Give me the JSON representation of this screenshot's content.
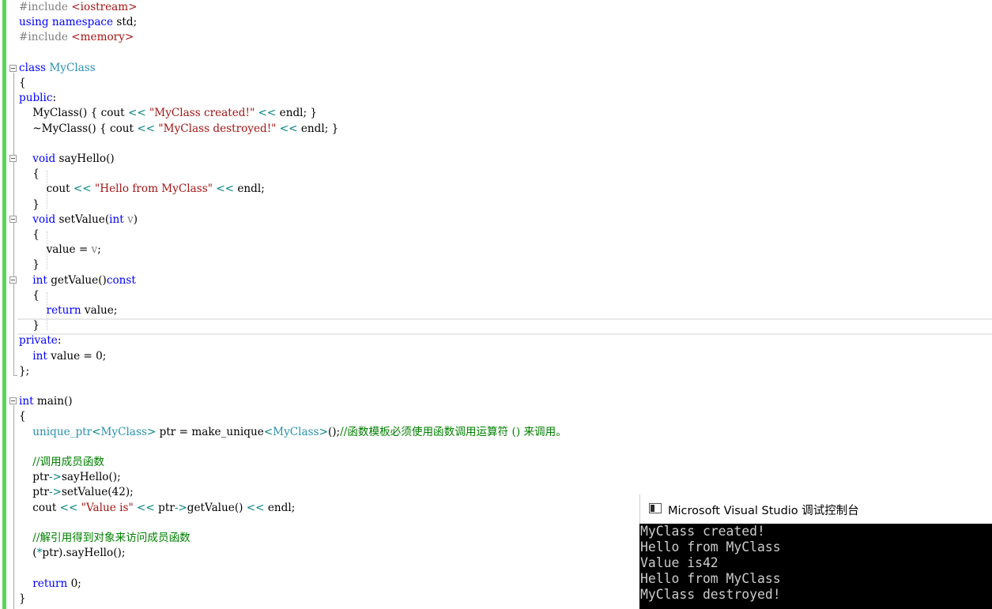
{
  "code_lines": [
    [
      {
        "t": "#include ",
        "c": "#808080"
      },
      {
        "t": "<iostream>",
        "c": "#a31515"
      }
    ],
    [
      {
        "t": "using namespace ",
        "c": "#0000ff"
      },
      {
        "t": "std;",
        "c": "#000000"
      }
    ],
    [
      {
        "t": "#include ",
        "c": "#808080"
      },
      {
        "t": "<memory>",
        "c": "#a31515"
      }
    ],
    [],
    [
      {
        "t": "class ",
        "c": "#0000ff"
      },
      {
        "t": "MyClass",
        "c": "#2b91af"
      }
    ],
    [
      {
        "t": "{",
        "c": "#000000"
      }
    ],
    [
      {
        "t": "public",
        "c": "#0000ff"
      },
      {
        "t": ":",
        "c": "#000000"
      }
    ],
    [
      {
        "t": "    MyClass() { cout ",
        "c": "#000000"
      },
      {
        "t": "<<",
        "c": "#008080"
      },
      {
        "t": " ",
        "c": "#000000"
      },
      {
        "t": "\"MyClass created!\"",
        "c": "#a31515"
      },
      {
        "t": " ",
        "c": "#000000"
      },
      {
        "t": "<<",
        "c": "#008080"
      },
      {
        "t": " endl; }",
        "c": "#000000"
      }
    ],
    [
      {
        "t": "    ~MyClass() { cout ",
        "c": "#000000"
      },
      {
        "t": "<<",
        "c": "#008080"
      },
      {
        "t": " ",
        "c": "#000000"
      },
      {
        "t": "\"MyClass destroyed!\"",
        "c": "#a31515"
      },
      {
        "t": " ",
        "c": "#000000"
      },
      {
        "t": "<<",
        "c": "#008080"
      },
      {
        "t": " endl; }",
        "c": "#000000"
      }
    ],
    [],
    [
      {
        "t": "    ",
        "c": "#000000"
      },
      {
        "t": "void",
        "c": "#0000ff"
      },
      {
        "t": " sayHello()",
        "c": "#000000"
      }
    ],
    [
      {
        "t": "    {",
        "c": "#000000"
      }
    ],
    [
      {
        "t": "        cout ",
        "c": "#000000"
      },
      {
        "t": "<<",
        "c": "#008080"
      },
      {
        "t": " ",
        "c": "#000000"
      },
      {
        "t": "\"Hello from MyClass\"",
        "c": "#a31515"
      },
      {
        "t": " ",
        "c": "#000000"
      },
      {
        "t": "<<",
        "c": "#008080"
      },
      {
        "t": " endl;",
        "c": "#000000"
      }
    ],
    [
      {
        "t": "    }",
        "c": "#000000"
      }
    ],
    [
      {
        "t": "    ",
        "c": "#000000"
      },
      {
        "t": "void",
        "c": "#0000ff"
      },
      {
        "t": " setValue(",
        "c": "#000000"
      },
      {
        "t": "int",
        "c": "#0000ff"
      },
      {
        "t": " ",
        "c": "#000000"
      },
      {
        "t": "v",
        "c": "#808080"
      },
      {
        "t": ")",
        "c": "#000000"
      }
    ],
    [
      {
        "t": "    {",
        "c": "#000000"
      }
    ],
    [
      {
        "t": "        value = ",
        "c": "#000000"
      },
      {
        "t": "v",
        "c": "#808080"
      },
      {
        "t": ";",
        "c": "#000000"
      }
    ],
    [
      {
        "t": "    }",
        "c": "#000000"
      }
    ],
    [
      {
        "t": "    ",
        "c": "#000000"
      },
      {
        "t": "int",
        "c": "#0000ff"
      },
      {
        "t": " getValue()",
        "c": "#000000"
      },
      {
        "t": "const",
        "c": "#0000ff"
      }
    ],
    [
      {
        "t": "    {",
        "c": "#000000"
      }
    ],
    [
      {
        "t": "        ",
        "c": "#000000"
      },
      {
        "t": "return",
        "c": "#0000ff"
      },
      {
        "t": " value;",
        "c": "#000000"
      }
    ],
    [
      {
        "t": "    }",
        "c": "#000000"
      }
    ],
    [
      {
        "t": "private",
        "c": "#0000ff"
      },
      {
        "t": ":",
        "c": "#000000"
      }
    ],
    [
      {
        "t": "    ",
        "c": "#000000"
      },
      {
        "t": "int",
        "c": "#0000ff"
      },
      {
        "t": " value = 0;",
        "c": "#000000"
      }
    ],
    [
      {
        "t": "};",
        "c": "#000000"
      }
    ],
    [],
    [
      {
        "t": "int",
        "c": "#0000ff"
      },
      {
        "t": " main()",
        "c": "#000000"
      }
    ],
    [
      {
        "t": "{",
        "c": "#000000"
      }
    ],
    [
      {
        "t": "    ",
        "c": "#000000"
      },
      {
        "t": "unique_ptr",
        "c": "#2b91af"
      },
      {
        "t": "<",
        "c": "#008080"
      },
      {
        "t": "MyClass",
        "c": "#2b91af"
      },
      {
        "t": ">",
        "c": "#008080"
      },
      {
        "t": " ptr = make_unique",
        "c": "#000000"
      },
      {
        "t": "<",
        "c": "#008080"
      },
      {
        "t": "MyClass",
        "c": "#2b91af"
      },
      {
        "t": ">",
        "c": "#008080"
      },
      {
        "t": "();",
        "c": "#000000"
      },
      {
        "t": "//函数模板必须使用函数调用运算符 () 来调用。",
        "c": "#008000"
      }
    ],
    [],
    [
      {
        "t": "    ",
        "c": "#000000"
      },
      {
        "t": "//调用成员函数",
        "c": "#008000"
      }
    ],
    [
      {
        "t": "    ptr",
        "c": "#000000"
      },
      {
        "t": "->",
        "c": "#008080"
      },
      {
        "t": "sayHello();",
        "c": "#000000"
      }
    ],
    [
      {
        "t": "    ptr",
        "c": "#000000"
      },
      {
        "t": "->",
        "c": "#008080"
      },
      {
        "t": "setValue(42);",
        "c": "#000000"
      }
    ],
    [
      {
        "t": "    cout ",
        "c": "#000000"
      },
      {
        "t": "<<",
        "c": "#008080"
      },
      {
        "t": " ",
        "c": "#000000"
      },
      {
        "t": "\"Value is\"",
        "c": "#a31515"
      },
      {
        "t": " ",
        "c": "#000000"
      },
      {
        "t": "<<",
        "c": "#008080"
      },
      {
        "t": " ptr",
        "c": "#000000"
      },
      {
        "t": "->",
        "c": "#008080"
      },
      {
        "t": "getValue() ",
        "c": "#000000"
      },
      {
        "t": "<<",
        "c": "#008080"
      },
      {
        "t": " endl;",
        "c": "#000000"
      }
    ],
    [],
    [
      {
        "t": "    ",
        "c": "#000000"
      },
      {
        "t": "//解引用得到对象来访问成员函数",
        "c": "#008000"
      }
    ],
    [
      {
        "t": "    (",
        "c": "#000000"
      },
      {
        "t": "*",
        "c": "#008080"
      },
      {
        "t": "ptr).sayHello();",
        "c": "#000000"
      }
    ],
    [],
    [
      {
        "t": "    ",
        "c": "#000000"
      },
      {
        "t": "return",
        "c": "#0000ff"
      },
      {
        "t": " 0;",
        "c": "#000000"
      }
    ],
    [
      {
        "t": "}",
        "c": "#000000"
      }
    ]
  ],
  "console": {
    "icon": "console-window-icon",
    "title": "Microsoft Visual Studio 调试控制台",
    "output": [
      "MyClass created!",
      "Hello from MyClass",
      "Value is42",
      "Hello from MyClass",
      "MyClass destroyed!"
    ]
  },
  "colors": {
    "keyword": "#0000ff",
    "type": "#2b91af",
    "string": "#a31515",
    "comment": "#008000",
    "operator": "#008080",
    "preprocessor": "#808080",
    "change_bar": "#5ad35a",
    "console_bg": "#000000",
    "console_text": "#cccccc"
  }
}
